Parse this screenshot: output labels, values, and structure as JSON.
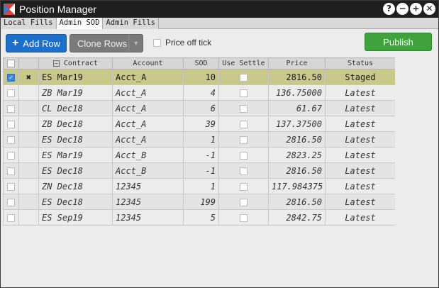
{
  "window": {
    "title": "Position Manager",
    "controls": [
      {
        "name": "help-icon",
        "glyph": "?"
      },
      {
        "name": "minimize-icon",
        "glyph": "−"
      },
      {
        "name": "maximize-icon",
        "glyph": "+"
      },
      {
        "name": "close-icon",
        "glyph": "✕"
      }
    ]
  },
  "tabs": [
    {
      "label": "Local Fills",
      "active": false
    },
    {
      "label": "Admin SOD",
      "active": true
    },
    {
      "label": "Admin Fills",
      "active": false
    }
  ],
  "toolbar": {
    "add_row_label": "Add Row",
    "clone_rows_label": "Clone Rows",
    "price_off_tick_label": "Price off tick",
    "publish_label": "Publish"
  },
  "grid": {
    "headers": [
      "",
      "",
      "Contract",
      "Account",
      "SOD",
      "Use Settle",
      "Price",
      "Status"
    ],
    "rows": [
      {
        "selected": true,
        "removable": true,
        "contract": "ES Mar19",
        "account": "Acct_A",
        "sod": "10",
        "price": "2816.50",
        "status": "Staged",
        "staged": true
      },
      {
        "selected": false,
        "removable": false,
        "contract": "ZB Mar19",
        "account": "Acct_A",
        "sod": "4",
        "price": "136.75000",
        "status": "Latest",
        "staged": false
      },
      {
        "selected": false,
        "removable": false,
        "contract": "CL Dec18",
        "account": "Acct_A",
        "sod": "6",
        "price": "61.67",
        "status": "Latest",
        "staged": false
      },
      {
        "selected": false,
        "removable": false,
        "contract": "ZB Dec18",
        "account": "Acct_A",
        "sod": "39",
        "price": "137.37500",
        "status": "Latest",
        "staged": false
      },
      {
        "selected": false,
        "removable": false,
        "contract": "ES Dec18",
        "account": "Acct_A",
        "sod": "1",
        "price": "2816.50",
        "status": "Latest",
        "staged": false
      },
      {
        "selected": false,
        "removable": false,
        "contract": "ES Mar19",
        "account": "Acct_B",
        "sod": "-1",
        "price": "2823.25",
        "status": "Latest",
        "staged": false
      },
      {
        "selected": false,
        "removable": false,
        "contract": "ES Dec18",
        "account": "Acct_B",
        "sod": "-1",
        "price": "2816.50",
        "status": "Latest",
        "staged": false
      },
      {
        "selected": false,
        "removable": false,
        "contract": "ZN Dec18",
        "account": "12345",
        "sod": "1",
        "price": "117.984375",
        "status": "Latest",
        "staged": false
      },
      {
        "selected": false,
        "removable": false,
        "contract": "ES Dec18",
        "account": "12345",
        "sod": "199",
        "price": "2816.50",
        "status": "Latest",
        "staged": false
      },
      {
        "selected": false,
        "removable": false,
        "contract": "ES Sep19",
        "account": "12345",
        "sod": "5",
        "price": "2842.75",
        "status": "Latest",
        "staged": false
      }
    ]
  },
  "colors": {
    "primary_button": "#1e6fc9",
    "publish_button": "#3fa23c",
    "staged_row": "#c8c88a",
    "titlebar": "#1f1f1f"
  }
}
